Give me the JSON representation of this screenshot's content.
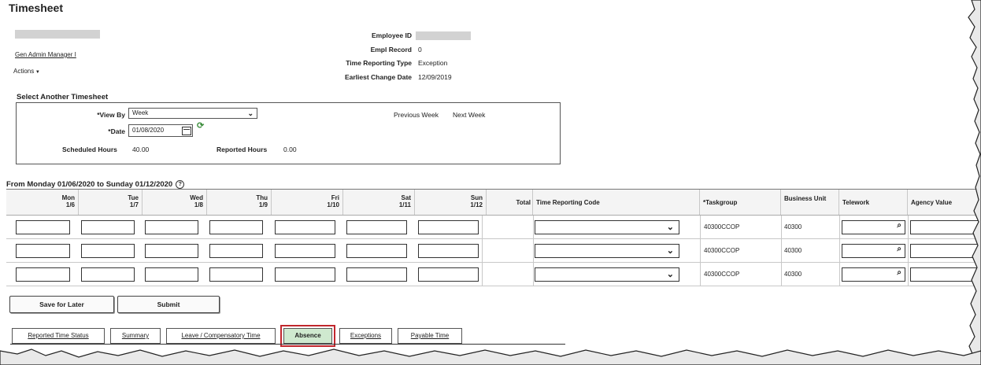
{
  "page": {
    "title": "Timesheet"
  },
  "employee": {
    "manager_link": "Gen Admin Manager I",
    "actions": "Actions",
    "fields": [
      {
        "label": "Employee ID",
        "value": ""
      },
      {
        "label": "Empl Record",
        "value": "0"
      },
      {
        "label": "Time Reporting Type",
        "value": "Exception"
      },
      {
        "label": "Earliest Change Date",
        "value": "12/09/2019"
      }
    ]
  },
  "select_timesheet": {
    "title": "Select Another Timesheet",
    "view_by_label": "*View By",
    "view_by_value": "Week",
    "date_label": "*Date",
    "date_value": "01/08/2020",
    "previous_week": "Previous Week",
    "next_week": "Next Week",
    "scheduled_hours_label": "Scheduled Hours",
    "scheduled_hours_value": "40.00",
    "reported_hours_label": "Reported Hours",
    "reported_hours_value": "0.00"
  },
  "range": {
    "text": "From Monday 01/06/2020 to Sunday 01/12/2020",
    "help_icon": "?"
  },
  "grid": {
    "days": [
      {
        "day": "Mon",
        "date": "1/6"
      },
      {
        "day": "Tue",
        "date": "1/7"
      },
      {
        "day": "Wed",
        "date": "1/8"
      },
      {
        "day": "Thu",
        "date": "1/9"
      },
      {
        "day": "Fri",
        "date": "1/10"
      },
      {
        "day": "Sat",
        "date": "1/11"
      },
      {
        "day": "Sun",
        "date": "1/12"
      }
    ],
    "headers": {
      "total": "Total",
      "trc": "Time Reporting Code",
      "taskgroup": "*Taskgroup",
      "business_unit": "Business Unit",
      "telework": "Telework",
      "agency_value": "Agency Value"
    },
    "rows": [
      {
        "taskgroup": "40300CCOP",
        "business_unit": "40300"
      },
      {
        "taskgroup": "40300CCOP",
        "business_unit": "40300"
      },
      {
        "taskgroup": "40300CCOP",
        "business_unit": "40300"
      }
    ]
  },
  "buttons": {
    "save_for_later": "Save for Later",
    "submit": "Submit"
  },
  "tabs": [
    {
      "label": "Reported Time Status",
      "active": false
    },
    {
      "label": "Summary",
      "active": false
    },
    {
      "label": "Leave / Compensatory Time",
      "active": false
    },
    {
      "label": "Absence",
      "active": true
    },
    {
      "label": "Exceptions",
      "active": false
    },
    {
      "label": "Payable Time",
      "active": false
    }
  ],
  "colors": {
    "active_tab_bg": "#cfe9cf",
    "highlight_border": "#c1272d"
  },
  "icons": {
    "dropdown": "chevron-down-icon",
    "lookup": "magnifier-icon",
    "calendar": "calendar-icon",
    "refresh": "refresh-icon",
    "help": "help-icon"
  }
}
